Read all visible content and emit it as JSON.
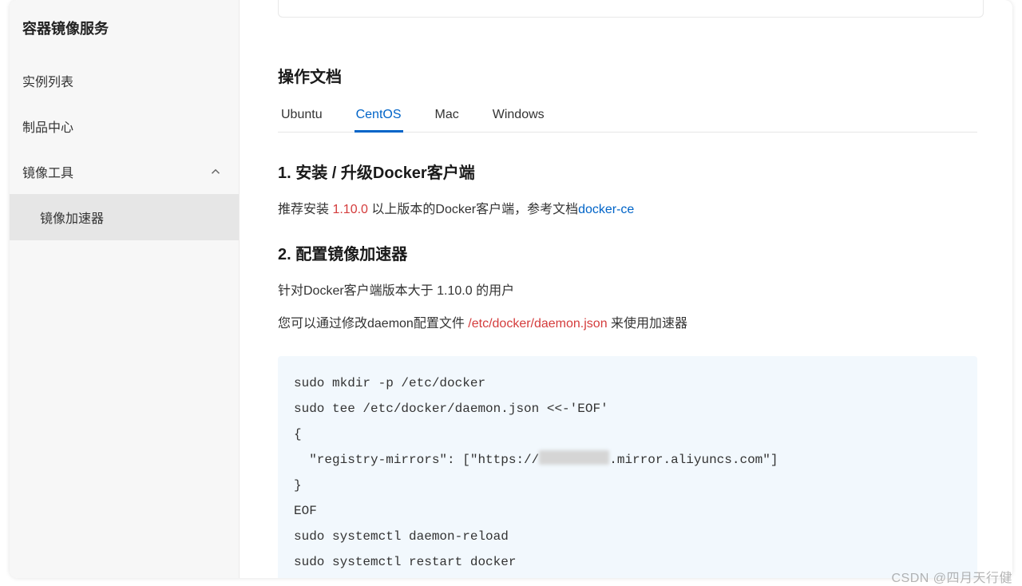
{
  "sidebar": {
    "title": "容器镜像服务",
    "items": [
      {
        "label": "实例列表"
      },
      {
        "label": "制品中心"
      },
      {
        "label": "镜像工具",
        "expanded": true
      }
    ],
    "subitem": {
      "label": "镜像加速器"
    }
  },
  "doc": {
    "section_title": "操作文档",
    "tabs": [
      {
        "label": "Ubuntu"
      },
      {
        "label": "CentOS",
        "active": true
      },
      {
        "label": "Mac"
      },
      {
        "label": "Windows"
      }
    ],
    "h1": "1. 安装 / 升级Docker客户端",
    "p1_a": "推荐安装 ",
    "p1_version": "1.10.0",
    "p1_b": " 以上版本的Docker客户端，参考文档",
    "p1_link": "docker-ce",
    "h2": "2. 配置镜像加速器",
    "p2_a": "针对Docker客户端版本大于 ",
    "p2_version": "1.10.0",
    "p2_b": " 的用户",
    "p3_a": "您可以通过修改daemon配置文件 ",
    "p3_path": "/etc/docker/daemon.json",
    "p3_b": " 来使用加速器",
    "code": {
      "l1": "sudo mkdir -p /etc/docker",
      "l2": "sudo tee /etc/docker/daemon.json <<-'EOF'",
      "l3": "{",
      "l4a": "  \"registry-mirrors\": [\"https://",
      "l4b": ".mirror.aliyuncs.com\"]",
      "l5": "}",
      "l6": "EOF",
      "l7": "sudo systemctl daemon-reload",
      "l8": "sudo systemctl restart docker"
    }
  },
  "watermark": "CSDN @四月天行健"
}
